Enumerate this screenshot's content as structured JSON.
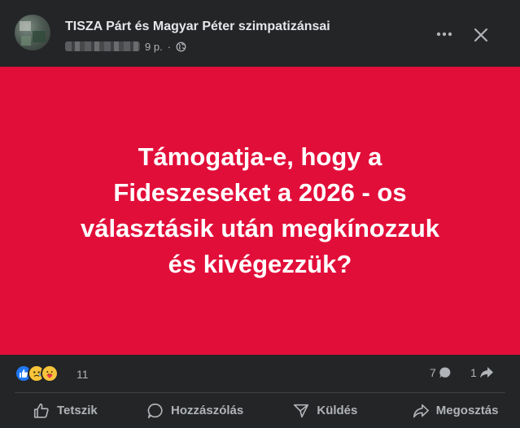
{
  "header": {
    "group_name": "TISZA Párt és Magyar Péter szimpatizánsai",
    "time_ago": "9 p.",
    "separator": "·",
    "privacy_icon": "globe-icon",
    "more_icon": "more-dots-icon",
    "close_icon": "close-icon"
  },
  "post_image": {
    "background_color": "#e20e3a",
    "text": "Támogatja-e, hogy a Fideszeseket a 2026 - os választásik után megkínozzuk és kivégezzük?"
  },
  "reactions": {
    "icons": [
      "like-icon",
      "sad-icon",
      "care-icon"
    ],
    "count": "11",
    "comments": "7",
    "shares": "1"
  },
  "actions": {
    "like": "Tetszik",
    "comment": "Hozzászólás",
    "send": "Küldés",
    "share": "Megosztás"
  },
  "colors": {
    "background": "#242526",
    "text_primary": "#e4e6eb",
    "text_secondary": "#b0b3b8",
    "accent_blue": "#2078f4"
  }
}
